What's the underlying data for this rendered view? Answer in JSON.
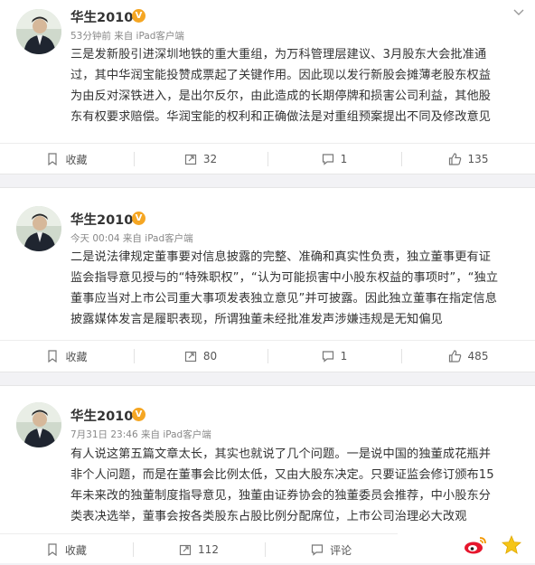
{
  "posts": [
    {
      "author": "华生2010",
      "meta": "53分钟前 来自 iPad客户端",
      "lines": [
        "三是发新股引进深圳地铁的重大重组，为万科管理层建议、3月股东大会批准通",
        "过，其中华润宝能投赞成票起了关键作用。因此现以发行新股会摊薄老股东权益",
        "为由反对深铁进入，是出尔反尔，由此造成的长期停牌和损害公司利益，其他股",
        "东有权要求赔偿。华润宝能的权利和正确做法是对重组预案提出不同及修改意见"
      ],
      "actions": {
        "save": "收藏",
        "repost": "32",
        "comment": "1",
        "like": "135"
      }
    },
    {
      "author": "华生2010",
      "meta": "今天 00:04 来自 iPad客户端",
      "lines": [
        "二是说法律规定董事要对信息披露的完整、准确和真实性负责，独立董事更有证",
        "监会指导意见授与的“特殊职权”，“认为可能损害中小股东权益的事项时”，“独立",
        "董事应当对上市公司重大事项发表独立意见”并可披露。因此独立董事在指定信息",
        "披露媒体发言是履职表现，所谓独董未经批准发声涉嫌违规是无知偏见"
      ],
      "actions": {
        "save": "收藏",
        "repost": "80",
        "comment": "1",
        "like": "485"
      }
    },
    {
      "author": "华生2010",
      "meta": "7月31日 23:46 来自 iPad客户端",
      "lines": [
        "有人说这第五篇文章太长，其实也就说了几个问题。一是说中国的独董成花瓶并",
        "非个人问题，而是在董事会比例太低，又由大股东决定。只要证监会修订颁布15",
        "年未来改的独董制度指导意见，独董由证券协会的独董委员会推荐，中小股东分",
        "类表决选举，董事会按各类股东占股比例分配席位，上市公司治理必大改观"
      ],
      "actions": {
        "save": "收藏",
        "repost": "112",
        "comment": "评论",
        "like": ""
      }
    }
  ],
  "colors": {
    "verified_badge": "#f5a623",
    "text": "#333333",
    "meta": "#888888",
    "weibo_red": "#e6162d"
  }
}
